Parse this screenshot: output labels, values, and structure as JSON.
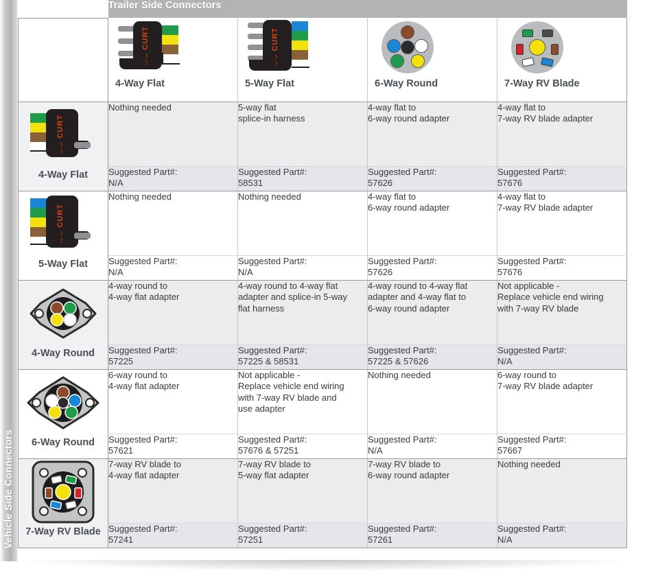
{
  "vertical_axis_label": "Vehicle Side Connectors",
  "banner_label": "Trailer Side Connectors",
  "colors": {
    "banner_bg": "#b3b3b3",
    "rail_gray": "#b4b4b4",
    "title_text": "#4b5056",
    "body_text": "#3b3b3b",
    "shade_row": "#eaecee",
    "plain_row": "#ffffff",
    "connector_black": "#231f20",
    "curt_orange": "#d4450f",
    "metal_gray": "#8f9194",
    "disc_gray": "#b9bbbd"
  },
  "brand_mark": "CURT",
  "columns": [
    {
      "id": "4-way-flat",
      "label": "4-Way Flat",
      "icon": "connector-4-way-flat-icon"
    },
    {
      "id": "5-way-flat",
      "label": "5-Way Flat",
      "icon": "connector-5-way-flat-icon"
    },
    {
      "id": "6-way-round",
      "label": "6-Way Round",
      "icon": "connector-6-way-round-icon"
    },
    {
      "id": "7-way-rv-blade",
      "label": "7-Way RV Blade",
      "icon": "connector-7-way-rv-blade-icon"
    }
  ],
  "rows": [
    {
      "id": "4-way-flat",
      "label": "4-Way Flat",
      "icon": "vehicle-4-way-flat-icon",
      "cells": [
        {
          "desc": [
            "Nothing needed"
          ],
          "part_label": "Suggested Part#:",
          "part": "N/A"
        },
        {
          "desc": [
            "5-way flat",
            "splice-in harness"
          ],
          "part_label": "Suggested Part#:",
          "part": "58531"
        },
        {
          "desc": [
            "4-way flat to",
            "6-way round adapter"
          ],
          "part_label": "Suggested Part#:",
          "part": "57626"
        },
        {
          "desc": [
            "4-way flat to",
            "7-way RV blade adapter"
          ],
          "part_label": "Suggested Part#:",
          "part": "57676"
        }
      ]
    },
    {
      "id": "5-way-flat",
      "label": "5-Way Flat",
      "icon": "vehicle-5-way-flat-icon",
      "cells": [
        {
          "desc": [
            "Nothing needed"
          ],
          "part_label": "Suggested Part#:",
          "part": "N/A"
        },
        {
          "desc": [
            "Nothing needed"
          ],
          "part_label": "Suggested Part#:",
          "part": "N/A"
        },
        {
          "desc": [
            "4-way flat to",
            "6-way round adapter"
          ],
          "part_label": "Suggested Part#:",
          "part": "57626"
        },
        {
          "desc": [
            "4-way flat to",
            "7-way RV blade adapter"
          ],
          "part_label": "Suggested Part#:",
          "part": "57676"
        }
      ]
    },
    {
      "id": "4-way-round",
      "label": "4-Way Round",
      "icon": "vehicle-4-way-round-icon",
      "cells": [
        {
          "desc": [
            "4-way round to",
            "4-way flat adapter"
          ],
          "part_label": "Suggested Part#:",
          "part": "57225"
        },
        {
          "desc": [
            "4-way round to 4-way flat",
            "adapter and splice-in 5-way",
            "flat harness"
          ],
          "part_label": "Suggested Part#:",
          "part": "57225 & 58531"
        },
        {
          "desc": [
            "4-way round to 4-way flat",
            "adapter and 4-way flat to",
            "6-way round adapter"
          ],
          "part_label": "Suggested Part#:",
          "part": "57225 & 57626"
        },
        {
          "desc": [
            "Not applicable -",
            "Replace vehicle end wiring",
            "with 7-way RV blade"
          ],
          "part_label": "Suggested Part#:",
          "part": "N/A"
        }
      ]
    },
    {
      "id": "6-way-round",
      "label": "6-Way Round",
      "icon": "vehicle-6-way-round-icon",
      "cells": [
        {
          "desc": [
            "6-way round to",
            "4-way flat adapter"
          ],
          "part_label": "Suggested Part#:",
          "part": "57621"
        },
        {
          "desc": [
            "Not applicable -",
            "Replace vehicle end wiring",
            "with 7-way RV blade and",
            "use adapter"
          ],
          "part_label": "Suggested Part#:",
          "part": "57676 & 57251"
        },
        {
          "desc": [
            "Nothing needed"
          ],
          "part_label": "Suggested Part#:",
          "part": "N/A"
        },
        {
          "desc": [
            "6-way round to",
            "7-way RV blade adapter"
          ],
          "part_label": "Suggested Part#:",
          "part": "57667"
        }
      ]
    },
    {
      "id": "7-way-rv-blade",
      "label": "7-Way RV Blade",
      "icon": "vehicle-7-way-rv-blade-icon",
      "cells": [
        {
          "desc": [
            "7-way RV blade to",
            "4-way flat adapter"
          ],
          "part_label": "Suggested Part#:",
          "part": "57241"
        },
        {
          "desc": [
            "7-way RV blade to",
            "5-way flat adapter"
          ],
          "part_label": "Suggested Part#:",
          "part": "57251"
        },
        {
          "desc": [
            "7-way RV blade to",
            "6-way round adapter"
          ],
          "part_label": "Suggested Part#:",
          "part": "57261"
        },
        {
          "desc": [
            "Nothing needed"
          ],
          "part_label": "Suggested Part#:",
          "part": "N/A"
        }
      ]
    }
  ],
  "wire_colors": {
    "flat_4way": [
      "#1e9c4a",
      "#f3e10b",
      "#8a6239",
      "#ffffff"
    ],
    "flat_5way": [
      "#1c86d6",
      "#1e9c4a",
      "#f3e10b",
      "#8a6239",
      "#ffffff"
    ],
    "round_6way": [
      "#8a4b2a",
      "#1c86d6",
      "#2b2b2b",
      "#ffffff",
      "#1e9c4a",
      "#f3e10b"
    ],
    "round_4way": [
      "#8a4b2a",
      "#1e9c4a",
      "#f3e10b",
      "#ffffff"
    ],
    "rv_7way": [
      "#1e9c4a",
      "#4a4a4a",
      "#d1232a",
      "#8a4b2a",
      "#ffffff",
      "#1c86d6",
      "#f3e10b"
    ]
  }
}
